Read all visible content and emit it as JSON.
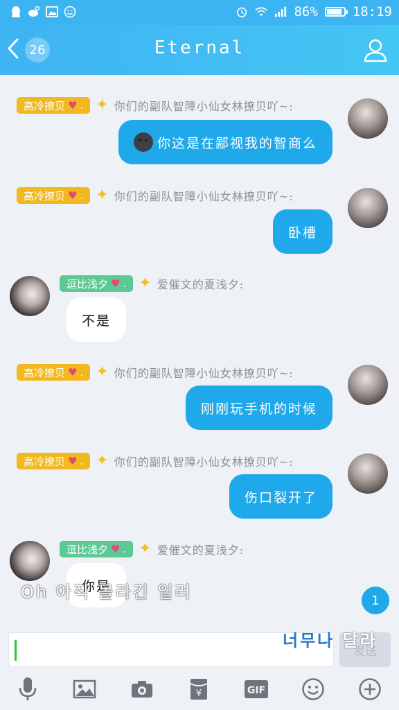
{
  "status_bar": {
    "battery": "86%",
    "time": "18:19"
  },
  "header": {
    "unread_count": "26",
    "title": "Eternal"
  },
  "messages": [
    {
      "tag": "高冷撩贝",
      "tag_color": "#f1b91f",
      "nick": "你们的副队智障小仙女林撩贝吖~:",
      "text": "你这是在鄙视我的智商么",
      "emoji": "moon-face-icon"
    },
    {
      "tag": "高冷撩贝",
      "tag_color": "#f1b91f",
      "nick": "你们的副队智障小仙女林撩贝吖~:",
      "text": "卧槽"
    },
    {
      "tag": "逗比浅夕",
      "tag_color": "#5cc995",
      "nick": "爱催文的夏浅夕:",
      "text": "不是"
    },
    {
      "tag": "高冷撩贝",
      "tag_color": "#f1b91f",
      "nick": "你们的副队智障小仙女林撩贝吖~:",
      "text": "刚刚玩手机的时候"
    },
    {
      "tag": "高冷撩贝",
      "tag_color": "#f1b91f",
      "nick": "你们的副队智障小仙女林撩贝吖~:",
      "text": "伤口裂开了"
    },
    {
      "tag": "逗比浅夕",
      "tag_color": "#5cc995",
      "nick": "爱催文的夏浅夕:",
      "text": "你是"
    }
  ],
  "overlay": {
    "lyric_line1": "Oh 아직 몰라긴 일러",
    "lyric_line2a": "너무나",
    "lyric_line2b": " 달라"
  },
  "scroll_badge": "1",
  "input": {
    "value": "",
    "send_label": "发送"
  },
  "toolbar": [
    "microphone-icon",
    "image-icon",
    "camera-icon",
    "red-packet-icon",
    "gif-icon",
    "emoji-icon",
    "plus-icon"
  ],
  "colors": {
    "accent": "#1fa8ea",
    "header": "#3fb3f3",
    "gold_tag": "#f1b91f",
    "green_tag": "#5cc995"
  }
}
